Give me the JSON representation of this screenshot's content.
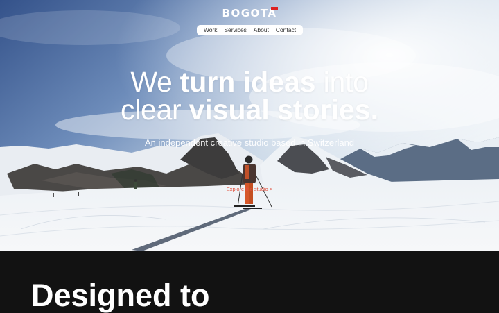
{
  "brand": {
    "logo_text": "BOGOTA",
    "flag_color": "#dd2222"
  },
  "nav": {
    "items": [
      "Work",
      "Services",
      "About",
      "Contact"
    ]
  },
  "hero": {
    "headline_line1_light": "We ",
    "headline_line1_bold": "turn ideas",
    "headline_line1_end": " into",
    "headline_line2_light": "clear ",
    "headline_line2_bold": "visual stories.",
    "tagline": "An independent creative studio based in Switzerland",
    "cta": "Explore the studio >"
  },
  "section": {
    "title": "Designed to"
  },
  "colors": {
    "accent": "#e0523f",
    "dark_bg": "#121212",
    "nav_bg": "#ffffff"
  }
}
